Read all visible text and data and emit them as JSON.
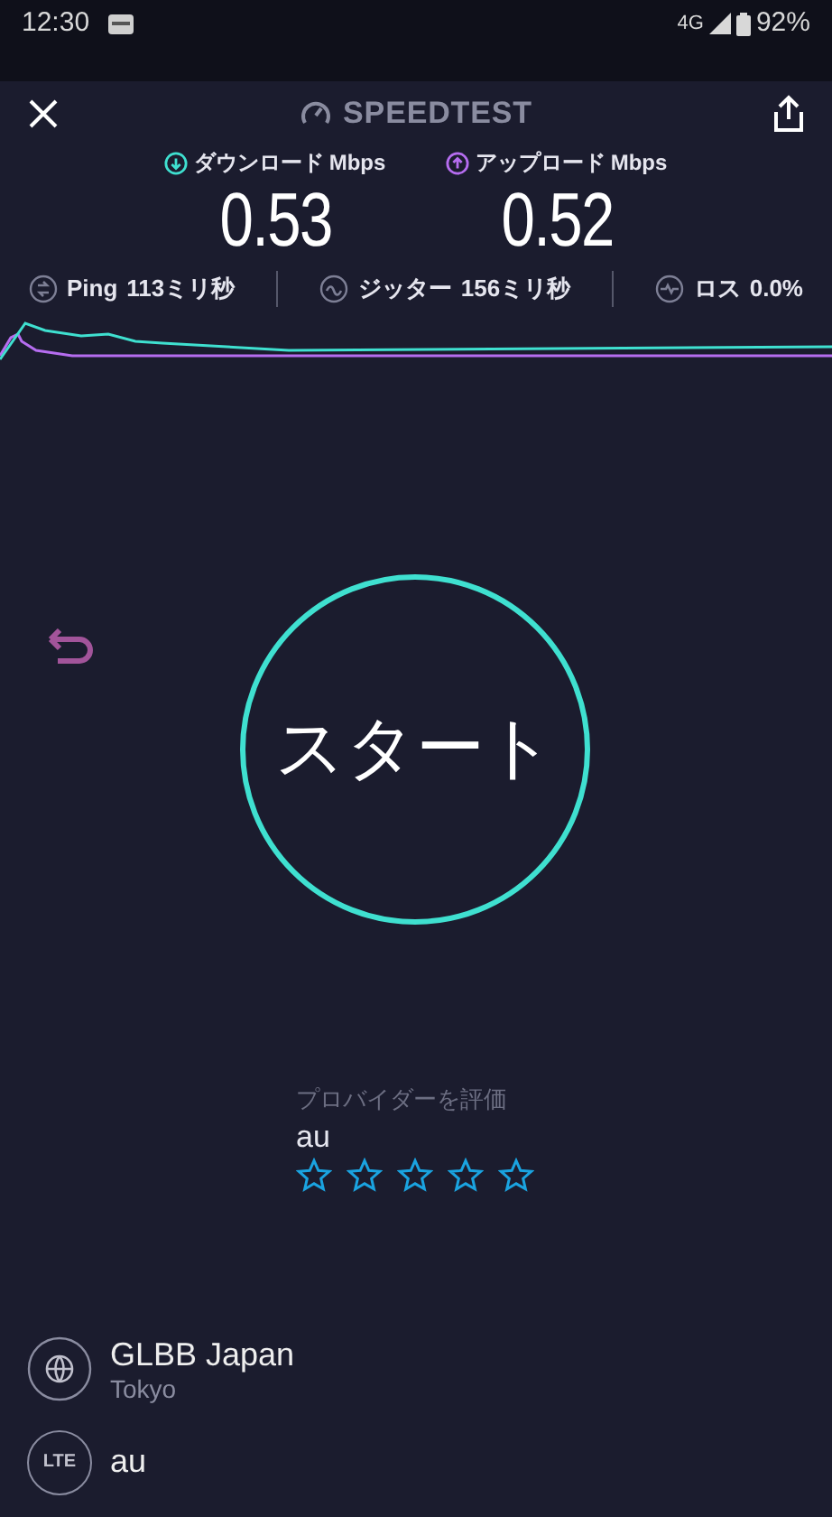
{
  "status_bar": {
    "time": "12:30",
    "network": "4G",
    "battery": "92%"
  },
  "header": {
    "title": "SPEEDTEST"
  },
  "download": {
    "label": "ダウンロード",
    "unit": "Mbps",
    "value": "0.53"
  },
  "upload": {
    "label": "アップロード",
    "unit": "Mbps",
    "value": "0.52"
  },
  "stats": [
    {
      "kind": "ping",
      "label": "Ping",
      "value": "113ミリ秒"
    },
    {
      "kind": "jitter",
      "label": "ジッター",
      "value": "156ミリ秒"
    },
    {
      "kind": "loss",
      "label": "ロス",
      "value": "0.0%"
    }
  ],
  "start_button": {
    "label": "スタート"
  },
  "rating": {
    "prompt": "プロバイダーを評価",
    "provider": "au",
    "stars": 0
  },
  "server": {
    "name": "GLBB Japan",
    "location": "Tokyo"
  },
  "connection": {
    "badge": "LTE",
    "carrier": "au"
  }
}
